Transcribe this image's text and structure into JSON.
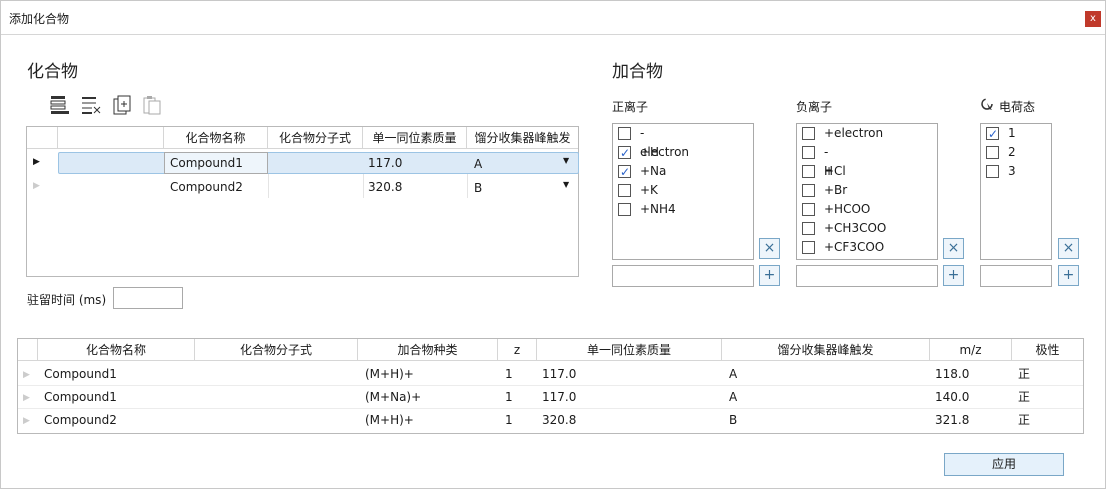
{
  "window": {
    "title": "添加化合物",
    "close_label": "x"
  },
  "compounds": {
    "heading": "化合物",
    "toolbar": [
      "add-row-icon",
      "delete-row-icon",
      "paste-add-icon",
      "copy-icon"
    ],
    "columns": [
      "化合物名称",
      "化合物分子式",
      "单一同位素质量",
      "馏分收集器峰触发"
    ],
    "rows": [
      {
        "name": "Compound1",
        "formula": "",
        "mass": "117.0",
        "trigger": "A",
        "selected": true
      },
      {
        "name": "Compound2",
        "formula": "",
        "mass": "320.8",
        "trigger": "B",
        "selected": false
      }
    ],
    "dwell_label": "驻留时间 (ms)",
    "dwell_value": ""
  },
  "adducts": {
    "heading": "加合物",
    "positive": {
      "label": "正离子",
      "items": [
        {
          "text": "-electron",
          "checked": false
        },
        {
          "text": "+H",
          "checked": true
        },
        {
          "text": "+Na",
          "checked": true
        },
        {
          "text": "+K",
          "checked": false
        },
        {
          "text": "+NH4",
          "checked": false
        }
      ]
    },
    "negative": {
      "label": "负离子",
      "items": [
        {
          "text": "+electron",
          "checked": false
        },
        {
          "text": "-H",
          "checked": false
        },
        {
          "text": "+Cl",
          "checked": false
        },
        {
          "text": "+Br",
          "checked": false
        },
        {
          "text": "+HCOO",
          "checked": false
        },
        {
          "text": "+CH3COO",
          "checked": false
        },
        {
          "text": "+CF3COO",
          "checked": false
        }
      ]
    },
    "charge": {
      "label": "电荷态",
      "items": [
        {
          "text": "1",
          "checked": true
        },
        {
          "text": "2",
          "checked": false
        },
        {
          "text": "3",
          "checked": false
        }
      ]
    },
    "clear_label": "×",
    "add_label": "+"
  },
  "results": {
    "columns": [
      "化合物名称",
      "化合物分子式",
      "加合物种类",
      "z",
      "单一同位素质量",
      "馏分收集器峰触发",
      "m/z",
      "极性"
    ],
    "rows": [
      {
        "name": "Compound1",
        "formula": "",
        "adduct": "(M+H)+",
        "z": "1",
        "mass": "117.0",
        "trigger": "A",
        "mz": "118.0",
        "polarity": "正"
      },
      {
        "name": "Compound1",
        "formula": "",
        "adduct": "(M+Na)+",
        "z": "1",
        "mass": "117.0",
        "trigger": "A",
        "mz": "140.0",
        "polarity": "正"
      },
      {
        "name": "Compound2",
        "formula": "",
        "adduct": "(M+H)+",
        "z": "1",
        "mass": "320.8",
        "trigger": "B",
        "mz": "321.8",
        "polarity": "正"
      }
    ]
  },
  "apply_label": "应用",
  "colors": {
    "selected_row": "#dceaf7",
    "accent": "#3a6f97"
  }
}
